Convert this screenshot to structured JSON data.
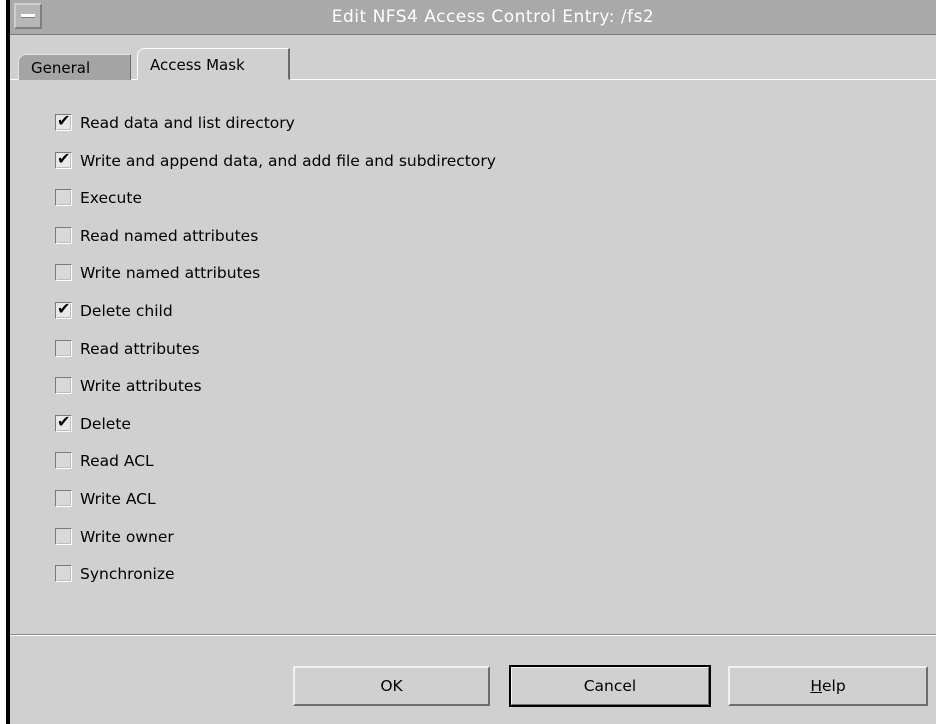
{
  "window": {
    "title": "Edit NFS4 Access Control Entry: /fs2"
  },
  "tabs": [
    {
      "label": "General",
      "selected": false
    },
    {
      "label": "Access Mask",
      "selected": true
    }
  ],
  "access_mask": {
    "items": [
      {
        "label": "Read data and list directory",
        "checked": true
      },
      {
        "label": "Write and append data, and add file and subdirectory",
        "checked": true
      },
      {
        "label": "Execute",
        "checked": false
      },
      {
        "label": "Read named attributes",
        "checked": false
      },
      {
        "label": "Write named attributes",
        "checked": false
      },
      {
        "label": "Delete child",
        "checked": true
      },
      {
        "label": "Read attributes",
        "checked": false
      },
      {
        "label": "Write attributes",
        "checked": false
      },
      {
        "label": "Delete",
        "checked": true
      },
      {
        "label": "Read ACL",
        "checked": false
      },
      {
        "label": "Write ACL",
        "checked": false
      },
      {
        "label": "Write owner",
        "checked": false
      },
      {
        "label": "Synchronize",
        "checked": false
      }
    ]
  },
  "buttons": {
    "ok_label": "OK",
    "cancel_label": "Cancel",
    "help_mnemonic": "H",
    "help_rest": "elp"
  },
  "icons": {
    "window_menu": "window-menu-icon",
    "check": "check-mark-icon"
  },
  "colors": {
    "dialog_bg": "#d0d0d0",
    "titlebar_bg": "#a9a9a9",
    "title_text": "#ffffff"
  }
}
